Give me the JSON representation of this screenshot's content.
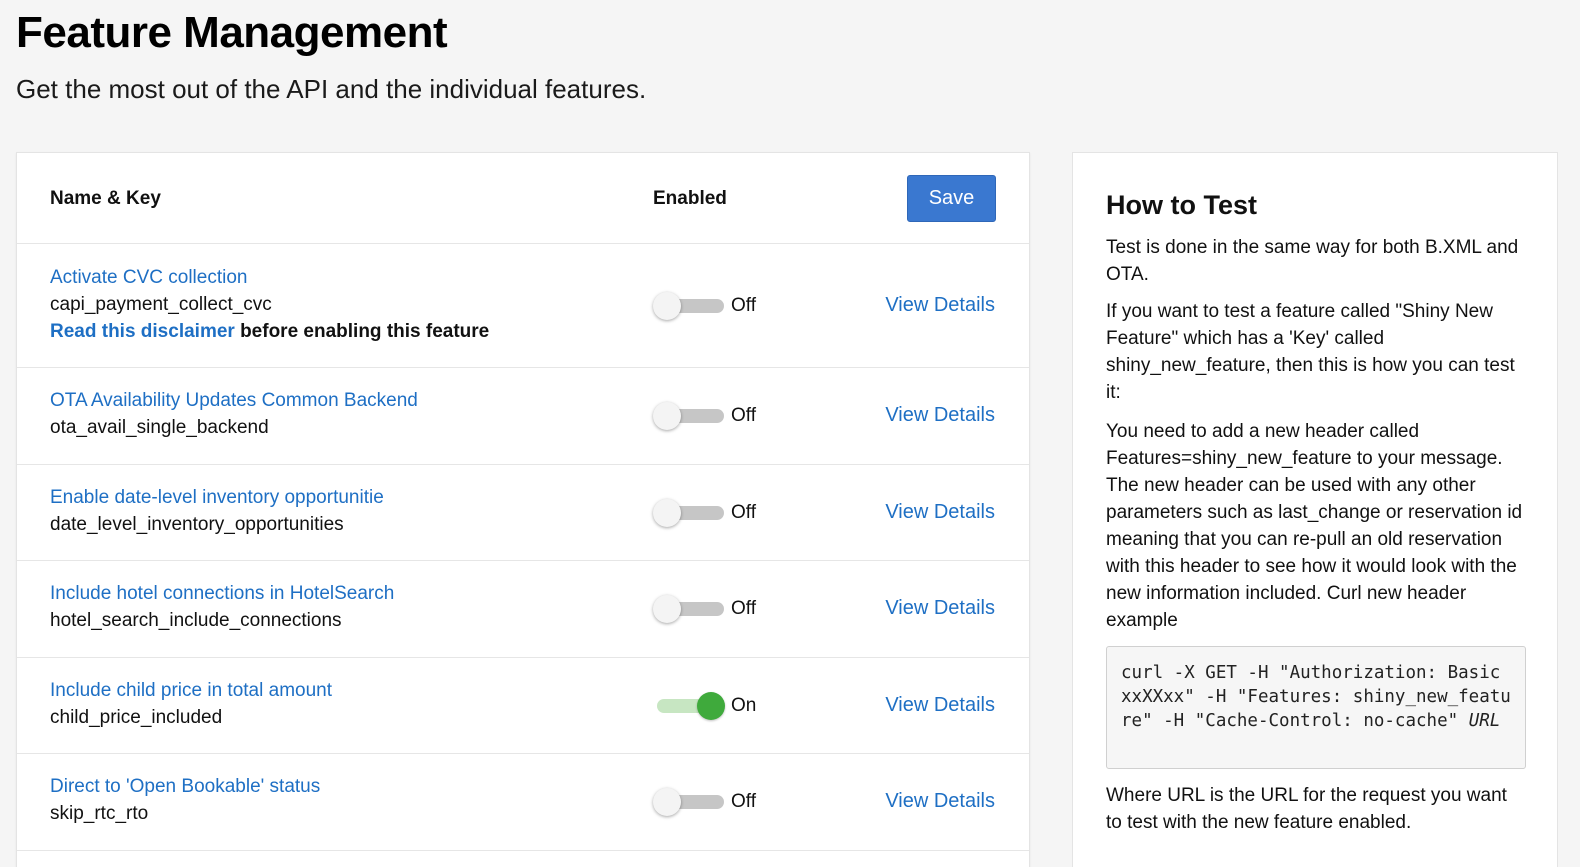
{
  "page": {
    "title": "Feature Management",
    "subtitle": "Get the most out of the API and the individual features."
  },
  "table": {
    "col_name": "Name & Key",
    "col_enabled": "Enabled",
    "save_label": "Save",
    "view_details_label": "View Details",
    "features": [
      {
        "name": "Activate CVC collection",
        "key": "capi_payment_collect_cvc",
        "disclaimer_link": "Read this disclaimer",
        "disclaimer_text": " before enabling this feature",
        "state": "Off"
      },
      {
        "name": "OTA Availability Updates Common Backend",
        "key": "ota_avail_single_backend",
        "state": "Off"
      },
      {
        "name": "Enable date-level inventory opportunitie",
        "key": "date_level_inventory_opportunities",
        "state": "Off"
      },
      {
        "name": "Include hotel connections in HotelSearch",
        "key": "hotel_search_include_connections",
        "state": "Off"
      },
      {
        "name": "Include child price in total amount",
        "key": "child_price_included",
        "state": "On"
      },
      {
        "name": "Direct to 'Open Bookable' status",
        "key": "skip_rtc_rto",
        "state": "Off"
      }
    ]
  },
  "howto": {
    "title": "How to Test",
    "p1": "Test is done in the same way for both B.XML and OTA.",
    "p2": "If you want to test a feature called \"Shiny New Feature\" which has a 'Key' called shiny_new_feature, then this is how you can test it:",
    "p3": "You need to add a new header called Features=shiny_new_feature to your message. The new header can be used with any other parameters such as last_change or reservation id meaning that you can re-pull an old reservation with this header to see how it would look with the new information included. Curl new header example",
    "code": "curl -X GET -H \"Authorization: Basic xxXXxx\" -H \"Features: shiny_new_feature\" -H \"Cache-Control: no-cache\" ",
    "code_url": "URL",
    "p4": "Where URL is the URL for the request you want to test with the new feature enabled."
  },
  "colors": {
    "link": "#1e6fc4",
    "save_button": "#3a78d0",
    "toggle_on": "#3faa3c",
    "toggle_off_track": "#c6c6c6"
  }
}
